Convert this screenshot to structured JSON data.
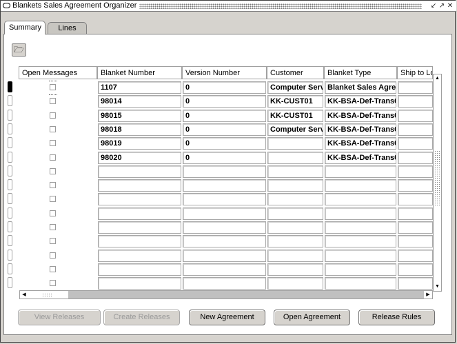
{
  "window": {
    "title": "Blankets Sales Agreement Organizer",
    "controls": [
      "↙",
      "↗",
      "✕"
    ]
  },
  "tabs": [
    {
      "label": "Summary",
      "active": true
    },
    {
      "label": "Lines",
      "active": false
    }
  ],
  "toolbar": {
    "folder_icon": "folder-icon"
  },
  "table": {
    "columns": [
      "Open Messages",
      "Blanket Number",
      "Version Number",
      "Customer",
      "Blanket Type",
      "Ship to Lo"
    ],
    "rows": [
      {
        "number": "1107",
        "version": "0",
        "customer": "Computer Serv",
        "type": "Blanket Sales Agre"
      },
      {
        "number": "98014",
        "version": "0",
        "customer": "KK-CUST01",
        "type": "KK-BSA-Def-Trans0"
      },
      {
        "number": "98015",
        "version": "0",
        "customer": "KK-CUST01",
        "type": "KK-BSA-Def-Trans0"
      },
      {
        "number": "98018",
        "version": "0",
        "customer": "Computer Serv",
        "type": "KK-BSA-Def-Trans0"
      },
      {
        "number": "98019",
        "version": "0",
        "customer": "",
        "type": "KK-BSA-Def-Trans0"
      },
      {
        "number": "98020",
        "version": "0",
        "customer": "",
        "type": "KK-BSA-Def-Trans0"
      },
      {
        "number": "",
        "version": "",
        "customer": "",
        "type": ""
      },
      {
        "number": "",
        "version": "",
        "customer": "",
        "type": ""
      },
      {
        "number": "",
        "version": "",
        "customer": "",
        "type": ""
      },
      {
        "number": "",
        "version": "",
        "customer": "",
        "type": ""
      },
      {
        "number": "",
        "version": "",
        "customer": "",
        "type": ""
      },
      {
        "number": "",
        "version": "",
        "customer": "",
        "type": ""
      },
      {
        "number": "",
        "version": "",
        "customer": "",
        "type": ""
      },
      {
        "number": "",
        "version": "",
        "customer": "",
        "type": ""
      },
      {
        "number": "",
        "version": "",
        "customer": "",
        "type": ""
      }
    ]
  },
  "buttons": [
    {
      "label": "View Releases",
      "enabled": false
    },
    {
      "label": "Create Releases",
      "enabled": false
    },
    {
      "label": "New Agreement",
      "enabled": true
    },
    {
      "label": "Open Agreement",
      "enabled": true
    },
    {
      "label": "Release Rules",
      "enabled": true
    }
  ]
}
